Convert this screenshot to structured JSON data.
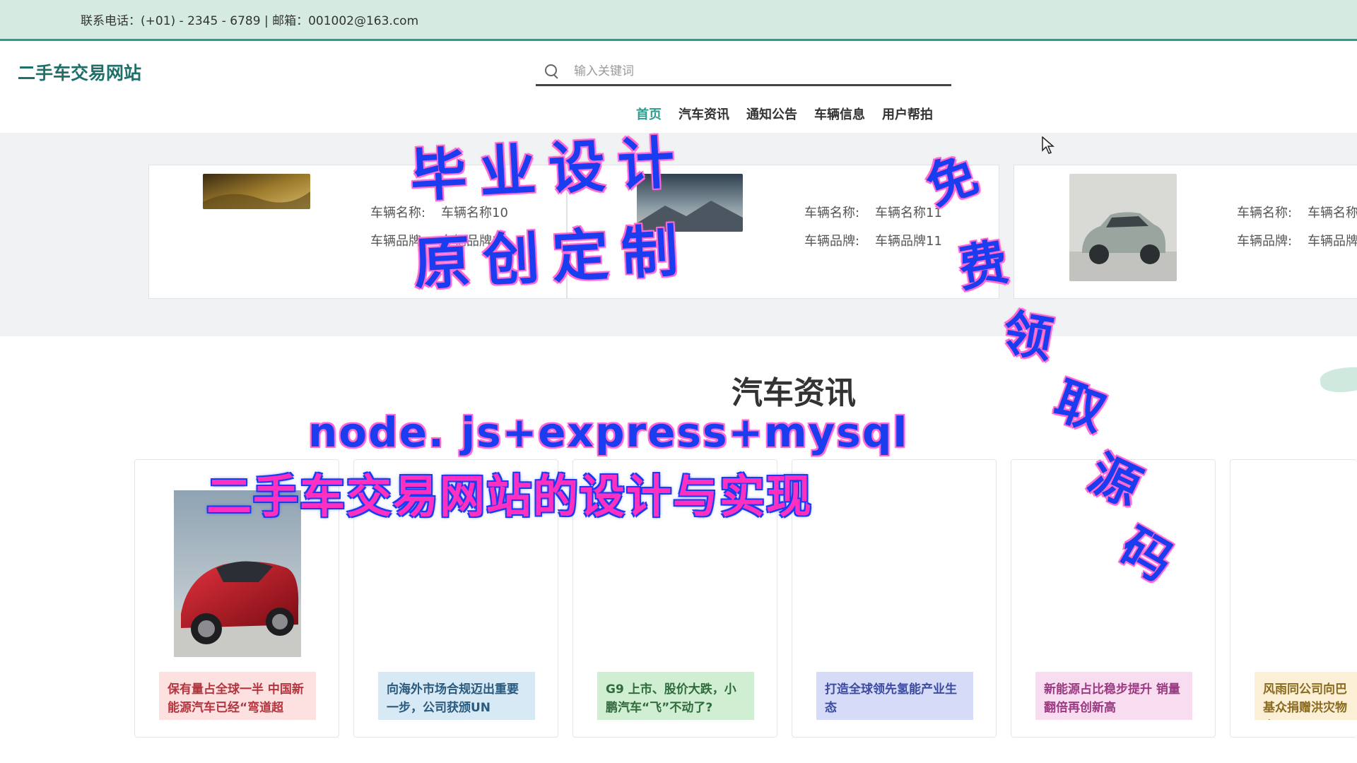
{
  "topbar": {
    "contact_text": "联系电话：(+01) - 2345 - 6789 | 邮箱：001002@163.com"
  },
  "header": {
    "logo": "二手车交易网站",
    "search_placeholder": "输入关键词",
    "nav": [
      "首页",
      "汽车资讯",
      "通知公告",
      "车辆信息",
      "用户帮拍"
    ],
    "active_nav": 0
  },
  "vehicles": [
    {
      "name_label": "车辆名称:",
      "name": "车辆名称10",
      "brand_label": "车辆品牌:",
      "brand": "车辆品牌10"
    },
    {
      "name_label": "车辆名称:",
      "name": "车辆名称11",
      "brand_label": "车辆品牌:",
      "brand": "车辆品牌11"
    },
    {
      "name_label": "车辆名称:",
      "name": "车辆名称",
      "brand_label": "车辆品牌:",
      "brand": "车辆品牌"
    }
  ],
  "news_section": {
    "title": "汽车资讯",
    "items": [
      {
        "title": "保有量占全球一半 中国新能源汽车已经“弯道超",
        "color": "#fde0e0"
      },
      {
        "title": "向海外市场合规迈出重要一步，公司获颁UN",
        "color": "#d6e9f5"
      },
      {
        "title": "G9 上市、股价大跌，小鹏汽车“飞”不动了?",
        "color": "#cfeed2"
      },
      {
        "title": "打造全球领先氢能产业生态",
        "color": "#d6dcf7"
      },
      {
        "title": "新能源占比稳步提升 销量翻倍再创新高",
        "color": "#f8ddf0"
      },
      {
        "title": "风雨同公司向巴基众捐赠洪灾物资",
        "color": "#fbf0d5"
      }
    ]
  },
  "overlay": {
    "line1": "毕业设计",
    "line2": "原创定制",
    "line3": "node. js+express+mysql",
    "line4": "二手车交易网站的设计与实现",
    "vertical": [
      "免",
      "费",
      "领",
      "取",
      "源",
      "码"
    ]
  },
  "colors": {
    "accent": "#2a9d8f",
    "topbar_bg": "#d5ebe1",
    "logo": "#1f6f6a",
    "band_bg": "#f0f2f3"
  }
}
